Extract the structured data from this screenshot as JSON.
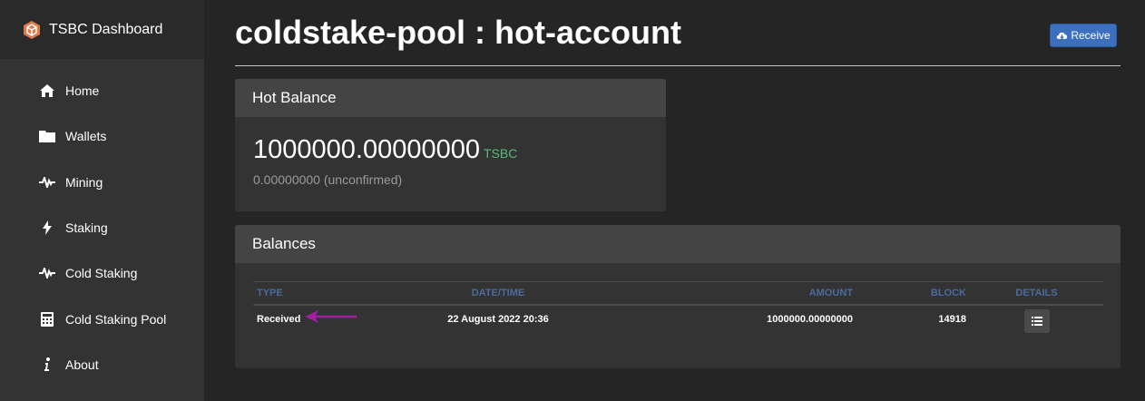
{
  "brand": {
    "title": "TSBC Dashboard"
  },
  "nav": [
    {
      "label": "Home",
      "icon": "home-icon"
    },
    {
      "label": "Wallets",
      "icon": "folder-icon"
    },
    {
      "label": "Mining",
      "icon": "pulse-icon"
    },
    {
      "label": "Staking",
      "icon": "bolt-icon"
    },
    {
      "label": "Cold Staking",
      "icon": "pulse-icon"
    },
    {
      "label": "Cold Staking Pool",
      "icon": "calculator-icon"
    },
    {
      "label": "About",
      "icon": "info-icon"
    }
  ],
  "page": {
    "title": "coldstake-pool : hot-account",
    "receive_label": "Receive"
  },
  "hot_balance": {
    "title": "Hot Balance",
    "amount": "1000000.00000000",
    "unit": "TSBC",
    "unconfirmed": "0.00000000 (unconfirmed)",
    "unit_color": "#5cb877"
  },
  "balances": {
    "title": "Balances",
    "columns": [
      "TYPE",
      "DATE/TIME",
      "AMOUNT",
      "BLOCK",
      "DETAILS"
    ],
    "rows": [
      {
        "type": "Received",
        "datetime": "22 August 2022 20:36",
        "amount": "1000000.00000000",
        "block": "14918",
        "details_icon": "list-icon"
      }
    ]
  },
  "annotation": {
    "arrow_color": "#a020a0",
    "icon": "arrow-left-icon"
  }
}
